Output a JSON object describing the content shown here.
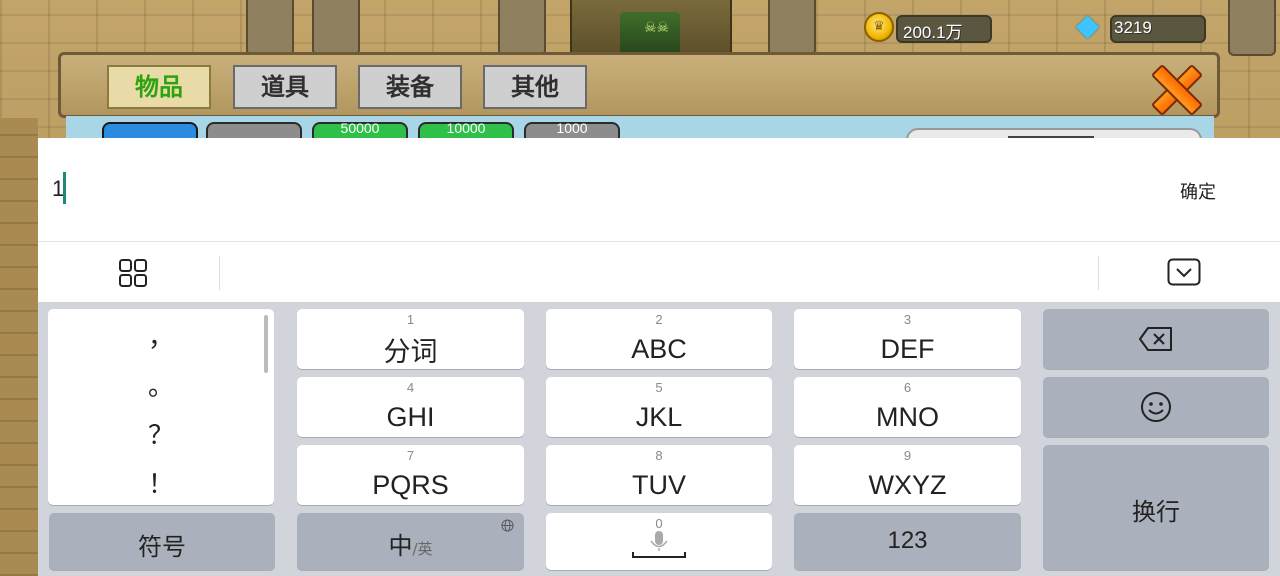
{
  "game": {
    "currency": {
      "gold": "200.1万",
      "diamond": "3219"
    },
    "tabs": [
      {
        "label": "物品",
        "active": true
      },
      {
        "label": "道具",
        "active": false
      },
      {
        "label": "装备",
        "active": false
      },
      {
        "label": "其他",
        "active": false
      }
    ],
    "slots": [
      "",
      "",
      "50000",
      "10000",
      "1000"
    ]
  },
  "input": {
    "value": "1",
    "confirm_label": "确定"
  },
  "keyboard": {
    "punctuation": [
      "，",
      "。",
      "？",
      "！"
    ],
    "keys": [
      {
        "num": "1",
        "label": "分词"
      },
      {
        "num": "2",
        "label": "ABC"
      },
      {
        "num": "3",
        "label": "DEF"
      },
      {
        "num": "4",
        "label": "GHI"
      },
      {
        "num": "5",
        "label": "JKL"
      },
      {
        "num": "6",
        "label": "MNO"
      },
      {
        "num": "7",
        "label": "PQRS"
      },
      {
        "num": "8",
        "label": "TUV"
      },
      {
        "num": "9",
        "label": "WXYZ"
      }
    ],
    "symbol_label": "符号",
    "lang_main": "中",
    "lang_alt": "/英",
    "space_num": "0",
    "numbers_label": "123",
    "enter_label": "换行",
    "icons": {
      "menu": "grid-menu-icon",
      "hide": "keyboard-hide-icon",
      "backspace": "backspace-icon",
      "emoji": "emoji-icon",
      "globe": "globe-icon",
      "mic": "microphone-icon"
    }
  }
}
